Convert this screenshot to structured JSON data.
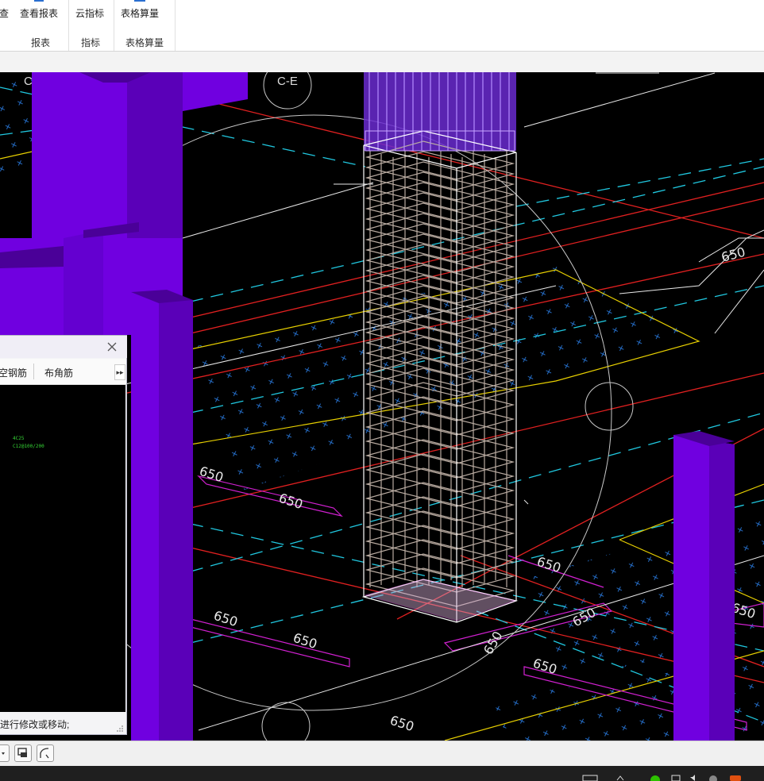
{
  "ribbon": {
    "groups": [
      {
        "buttons": [
          "查看报表"
        ],
        "partial_button": "查",
        "label": "报表"
      },
      {
        "buttons": [
          "云指标"
        ],
        "label": "指标"
      },
      {
        "buttons": [
          "表格算量"
        ],
        "label": "表格算量"
      }
    ]
  },
  "viewport": {
    "axis_labels": [
      "C",
      "C-E"
    ],
    "dimension_text": "650"
  },
  "dialog": {
    "tabs": [
      "空钢筋",
      "布角筋"
    ],
    "more_icon": "double-chevron-right-icon",
    "rebar_text": [
      "4C25",
      "C12@100/200"
    ],
    "status_text": "进行修改或移动;"
  },
  "bottom_toolbar": {
    "tools": [
      "dropdown-arrow-icon",
      "view-switch-icon",
      "curve-tool-icon"
    ]
  },
  "taskbar": {
    "tray_icons": [
      "keyboard-icon",
      "chevron-up-icon",
      "wechat-icon",
      "network-icon",
      "volume-icon",
      "close-circle-icon",
      "app-icon"
    ]
  },
  "colors": {
    "column_fill": "#7000e0",
    "column_side": "#5a00b8",
    "grid_red": "#e02020",
    "grid_cyan": "#20c8e0",
    "grid_yellow": "#e8d000",
    "grid_magenta": "#d020d0",
    "rebar": "#b8aaa0",
    "rebar_label": "#35d435"
  }
}
